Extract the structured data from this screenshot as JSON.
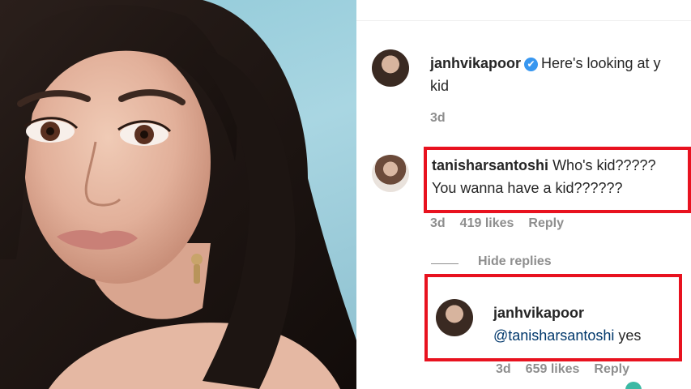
{
  "post_caption": {
    "username": "janhvikapoor",
    "text_line1": "Here's looking at y",
    "text_line2": "kid",
    "time": "3d"
  },
  "comment": {
    "username": "tanisharsantoshi",
    "text_line1": "Who's kid?????",
    "text_line2": "You wanna have a kid??????",
    "time": "3d",
    "likes": "419 likes",
    "reply": "Reply"
  },
  "hide_replies": "Hide replies",
  "reply_comment": {
    "username": "janhvikapoor",
    "mention": "@tanisharsantoshi",
    "text": "yes",
    "time": "3d",
    "likes": "659 likes",
    "reply": "Reply"
  },
  "verified_badge": "✔",
  "colors": {
    "highlight_box": "#e8121f",
    "muted_text": "#8e8e8e",
    "mention": "#00376b",
    "verified": "#3897f0"
  },
  "icons": [
    "verified-badge-icon"
  ]
}
